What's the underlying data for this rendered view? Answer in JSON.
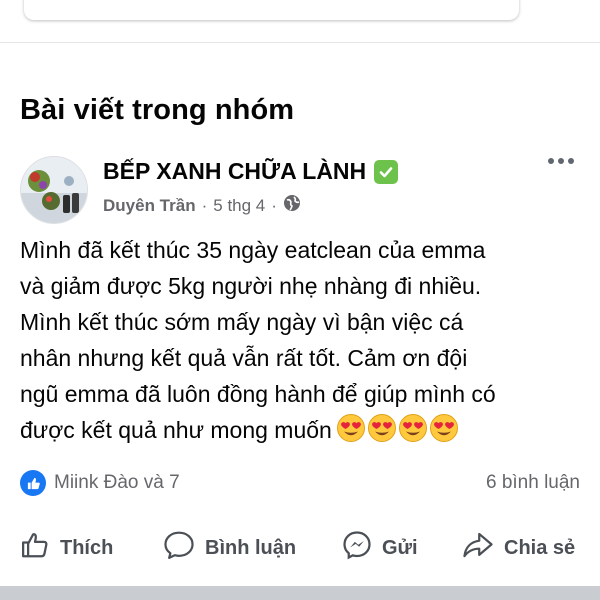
{
  "section": {
    "title": "Bài viết trong nhóm"
  },
  "post": {
    "group_name": "BẾP XANH CHỮA LÀNH",
    "author": "Duyên Trần",
    "separator": "·",
    "date": "5 thg 4",
    "lines": [
      "Mình đã kết thúc 35 ngày eatclean của emma",
      "và giảm được 5kg người nhẹ nhàng đi nhiều.",
      "Mình kết thúc sớm mấy ngày vì bận việc cá",
      "nhân nhưng kết quả vẫn rất tốt. Cảm ơn đội",
      "ngũ emma đã luôn đồng hành để giúp mình có",
      "được kết quả như mong muốn"
    ],
    "emoji_name": "heart-eyes-emoji",
    "emoji_count": 4
  },
  "reactions": {
    "text": "Miink Đào và 7",
    "comments": "6 bình luận"
  },
  "actions": {
    "like": "Thích",
    "comment": "Bình luận",
    "send": "Gửi",
    "share": "Chia sẻ"
  },
  "colors": {
    "like_blue": "#1877f2",
    "verified_green": "#6cc24a",
    "muted_text": "#65676b"
  }
}
